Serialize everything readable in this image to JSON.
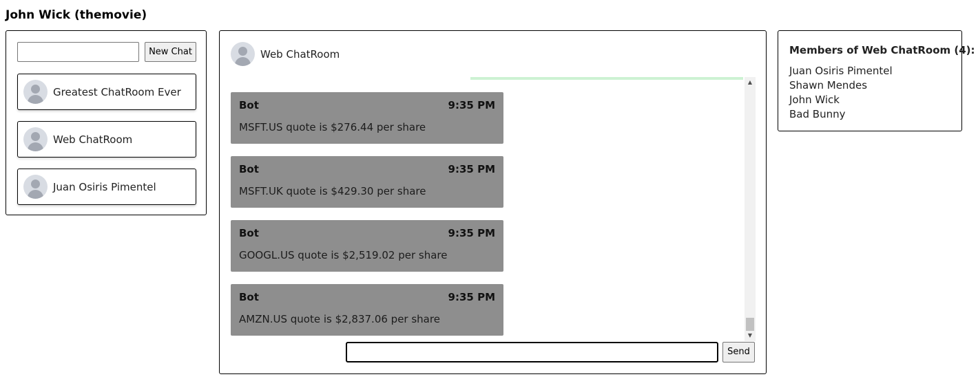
{
  "user": {
    "name": "John Wick (themovie)"
  },
  "sidebar": {
    "new_chat_value": "",
    "new_chat_button": "New Chat",
    "chats": [
      {
        "label": "Greatest ChatRoom Ever"
      },
      {
        "label": "Web ChatRoom"
      },
      {
        "label": "Juan Osiris Pimentel"
      }
    ]
  },
  "chat": {
    "title": "Web ChatRoom",
    "messages": [
      {
        "sender": "Bot",
        "time": "9:35 PM",
        "text": "MSFT.US quote is $276.44 per share"
      },
      {
        "sender": "Bot",
        "time": "9:35 PM",
        "text": "MSFT.UK quote is $429.30 per share"
      },
      {
        "sender": "Bot",
        "time": "9:35 PM",
        "text": "GOOGL.US quote is $2,519.02 per share"
      },
      {
        "sender": "Bot",
        "time": "9:35 PM",
        "text": "AMZN.US quote is $2,837.06 per share"
      }
    ],
    "input_value": "",
    "send_label": "Send"
  },
  "members": {
    "title": "Members of Web ChatRoom (4):",
    "list": [
      "Juan Osiris Pimentel",
      "Shawn Mendes",
      "John Wick",
      "Bad Bunny"
    ]
  },
  "colors": {
    "message_bg": "#8e8e8e",
    "scroll_indicator": "#cdf2d3",
    "avatar_bg": "#d8dce3",
    "avatar_fg": "#a3a8b2"
  },
  "icons": {
    "avatar": "user-avatar-icon",
    "scroll_up": "scroll-up-arrow-icon",
    "scroll_down": "scroll-down-arrow-icon"
  }
}
